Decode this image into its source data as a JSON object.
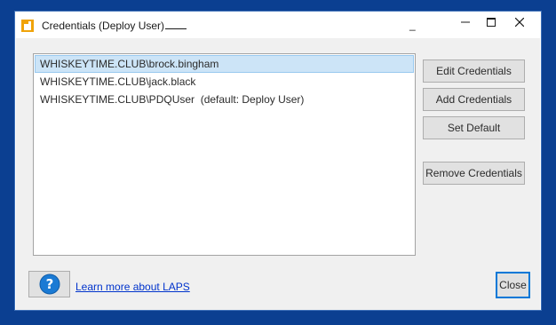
{
  "window": {
    "title": "Credentials (Deploy User)",
    "title_extra": "_",
    "controls": {
      "minimize_glyph": "–",
      "maximize_glyph": "□",
      "close_glyph": "✕"
    }
  },
  "credentials_list": {
    "items": [
      {
        "label": "WHISKEYTIME.CLUB\\brock.bingham",
        "selected": true
      },
      {
        "label": "WHISKEYTIME.CLUB\\jack.black",
        "selected": false
      },
      {
        "label": "WHISKEYTIME.CLUB\\PDQUser  (default: Deploy User)",
        "selected": false
      }
    ]
  },
  "actions": {
    "edit_label": "Edit Credentials",
    "add_label": "Add Credentials",
    "set_default_label": "Set Default",
    "remove_label": "Remove Credentials"
  },
  "footer": {
    "help_icon": "question-circle-icon",
    "learn_more_link": "Learn more about LAPS",
    "close_label": "Close"
  },
  "colors": {
    "desktop_background": "#0b3f91",
    "selection_background": "#cce4f7",
    "selection_border": "#99c9ef",
    "link": "#0033cc",
    "help_icon": "#1a7ad4",
    "app_icon": "#f0a30a",
    "close_button_focus": "#0078d7"
  }
}
